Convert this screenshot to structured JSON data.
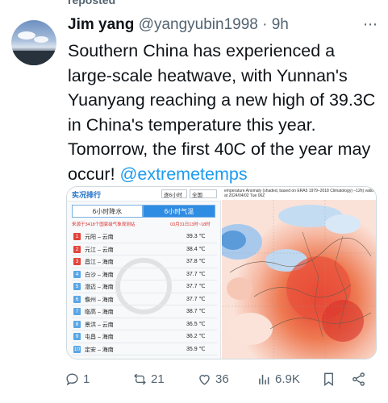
{
  "reposted_label": "reposted",
  "author": {
    "name": "Jim yang",
    "handle": "@yangyubin1998",
    "separator": "·",
    "time": "9h"
  },
  "tweet": {
    "text": "Southern China has experienced a large-scale heatwave, with Yunnan's Yuanyang reaching a new high of 39.3C in China's temperature this year. Tomorrow, the first 40C of the year may occur!",
    "mention": "@extremetemps"
  },
  "media_left": {
    "title": "实况排行",
    "select1": "逐6小时",
    "select2": "全国",
    "tab_rain": "6小时降水",
    "tab_temp": "6小时气温",
    "source": "来源于3418个国家级气象观测站",
    "time_range": "03月31日13时~18时",
    "rows": [
      {
        "rank": "1",
        "station": "元阳 – 云南",
        "temp": "39.3 ℃"
      },
      {
        "rank": "2",
        "station": "元江 – 云南",
        "temp": "38.4 ℃"
      },
      {
        "rank": "3",
        "station": "昌江 – 海南",
        "temp": "37.8 ℃"
      },
      {
        "rank": "4",
        "station": "白沙 – 海南",
        "temp": "37.7 ℃"
      },
      {
        "rank": "5",
        "station": "澄迈 – 海南",
        "temp": "37.7 ℃"
      },
      {
        "rank": "6",
        "station": "儋州 – 海南",
        "temp": "37.7 ℃"
      },
      {
        "rank": "7",
        "station": "临高 – 海南",
        "temp": "38.7 ℃"
      },
      {
        "rank": "8",
        "station": "景洪 – 云南",
        "temp": "36.5 ℃"
      },
      {
        "rank": "9",
        "station": "屯昌 – 海南",
        "temp": "36.2 ℃"
      },
      {
        "rank": "10",
        "station": "定安 – 海南",
        "temp": "35.9 ℃"
      }
    ]
  },
  "media_right": {
    "caption": "emperature Anomaly (shaded, based on ERA5 1979–2018 Climatology) –12h) valid at 2024/04/02 Tue 06Z"
  },
  "actions": {
    "replies": "1",
    "reposts": "21",
    "likes": "36",
    "views": "6.9K"
  },
  "colors": {
    "accent": "#1d9bf0",
    "muted": "#536471",
    "repost_green": "#00ba7c"
  }
}
